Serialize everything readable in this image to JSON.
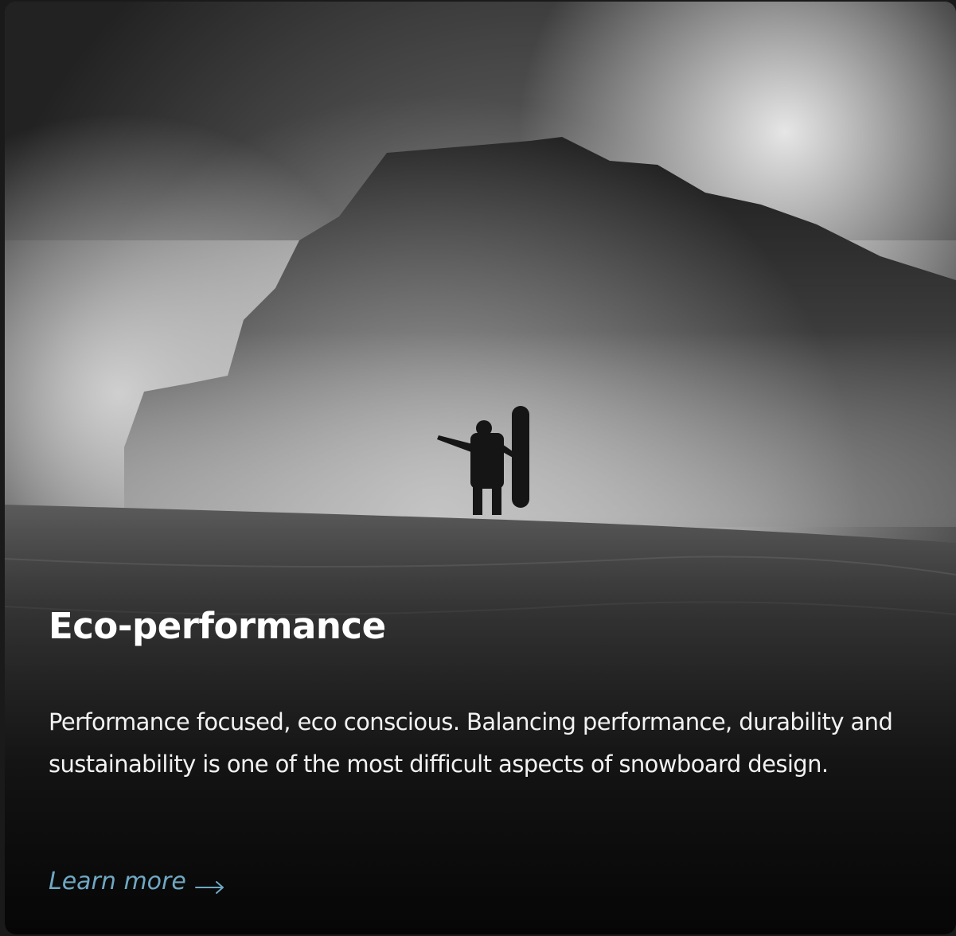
{
  "card": {
    "title": "Eco-performance",
    "description": "Performance focused, eco conscious. Balancing performance, durability and sustainability is one of the most difficult aspects of snowboard design.",
    "link_label": "Learn more",
    "link_icon": "arrow-right-icon",
    "link_color": "#6fa8c3"
  }
}
